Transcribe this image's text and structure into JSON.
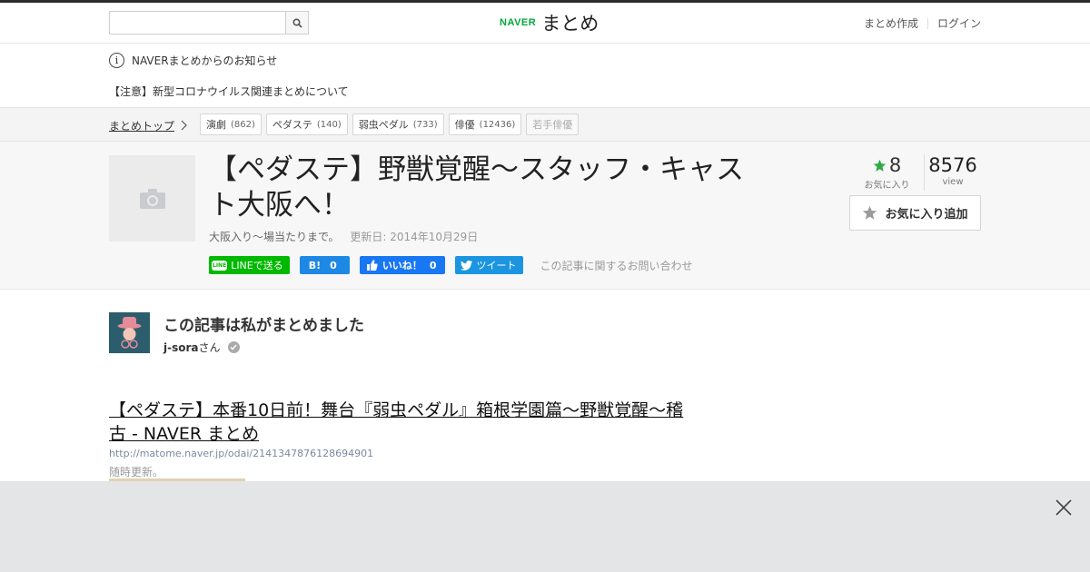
{
  "header": {
    "search_placeholder": "",
    "logo_brand": "NAVER",
    "logo_name": "まとめ",
    "links": [
      "まとめ作成",
      "ログイン"
    ]
  },
  "notices": {
    "title": "NAVERまとめからのお知らせ",
    "item": "【注意】新型コロナウイルス関連まとめについて"
  },
  "breadcrumb": {
    "top": "まとめトップ",
    "tags": [
      {
        "label": "演劇",
        "count": "(862)"
      },
      {
        "label": "ペダステ",
        "count": "(140)"
      },
      {
        "label": "弱虫ペダル",
        "count": "(733)"
      },
      {
        "label": "俳優",
        "count": "(12436)"
      },
      {
        "label": "若手俳優",
        "count": ""
      }
    ]
  },
  "article": {
    "title": "【ペダステ】野獣覚醒～スタッフ・キャスト大阪へ！",
    "description": "大阪入り～場当たりまで。",
    "updated": "更新日: 2014年10月29日",
    "share": {
      "line": "LINEで送る",
      "line_badge": "LINE",
      "hatena_label": "B!",
      "hatena_count": "0",
      "fb_label": "いいね！",
      "fb_count": "0",
      "tweet": "ツイート"
    },
    "contact": "この記事に関するお問い合わせ",
    "favorites": "8",
    "favorites_label": "お気に入り",
    "views": "8576",
    "views_label": "view",
    "fav_button": "お気に入り追加"
  },
  "author": {
    "heading": "この記事は私がまとめました",
    "name": "j-sora",
    "suffix": "さん"
  },
  "link_item": {
    "title": "【ペダステ】本番10日前！舞台『弱虫ペダル』箱根学園篇～野獣覚醒～稽古 - NAVER まとめ",
    "url": "http://matome.naver.jp/odai/2141347876128694901",
    "description": "随時更新。"
  },
  "colors": {
    "brand_green": "#00a83a",
    "line_green": "#00b900",
    "hatena_blue": "#1e88e5",
    "facebook_blue": "#1877f2",
    "twitter_blue": "#1b95e0",
    "star_green": "#2eaa44"
  }
}
